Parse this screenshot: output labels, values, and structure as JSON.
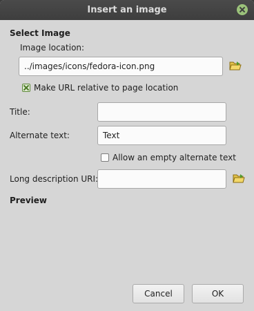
{
  "window": {
    "title": "Insert an image",
    "close_icon": "close-icon"
  },
  "select_image": {
    "heading": "Select Image",
    "location_label": "Image location:",
    "location_value": "../images/icons/fedora-icon.png",
    "browse_icon": "folder-open-icon",
    "relative_label": "Make URL relative to page location",
    "relative_checked": true
  },
  "fields": {
    "title_label": "Title:",
    "title_value": "",
    "alt_label": "Alternate text:",
    "alt_value": "Text",
    "empty_alt_label": "Allow an empty alternate text",
    "empty_alt_checked": false,
    "longdesc_label": "Long description URI:",
    "longdesc_value": "",
    "longdesc_browse_icon": "folder-open-icon"
  },
  "preview": {
    "heading": "Preview"
  },
  "buttons": {
    "cancel": "Cancel",
    "ok": "OK"
  },
  "colors": {
    "titlebar": "#3e3e3e",
    "dialog_bg": "#d6d6d6",
    "accent": "#9bc27a"
  }
}
